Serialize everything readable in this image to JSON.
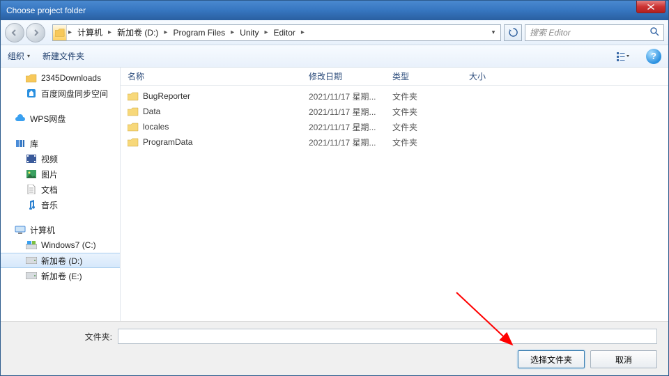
{
  "window": {
    "title": "Choose project folder"
  },
  "breadcrumb": {
    "segments": [
      "计算机",
      "新加卷 (D:)",
      "Program Files",
      "Unity",
      "Editor"
    ]
  },
  "search": {
    "placeholder": "搜索 Editor"
  },
  "toolbar": {
    "organize": "组织",
    "newfolder": "新建文件夹",
    "view_glyph": "☷",
    "help_glyph": "?"
  },
  "sidebar": {
    "top": [
      {
        "label": "2345Downloads",
        "icon": "folder"
      },
      {
        "label": "百度网盘同步空间",
        "icon": "baidu"
      }
    ],
    "wps": {
      "label": "WPS网盘"
    },
    "library": {
      "label": "库",
      "items": [
        {
          "label": "视频",
          "icon": "video"
        },
        {
          "label": "图片",
          "icon": "picture"
        },
        {
          "label": "文档",
          "icon": "doc"
        },
        {
          "label": "音乐",
          "icon": "music"
        }
      ]
    },
    "computer": {
      "label": "计算机",
      "items": [
        {
          "label": "Windows7 (C:)",
          "icon": "drive-win"
        },
        {
          "label": "新加卷 (D:)",
          "icon": "drive",
          "selected": true
        },
        {
          "label": "新加卷 (E:)",
          "icon": "drive"
        }
      ]
    }
  },
  "columns": {
    "name": "名称",
    "date": "修改日期",
    "type": "类型",
    "size": "大小"
  },
  "files": [
    {
      "name": "BugReporter",
      "date": "2021/11/17 星期...",
      "type": "文件夹"
    },
    {
      "name": "Data",
      "date": "2021/11/17 星期...",
      "type": "文件夹"
    },
    {
      "name": "locales",
      "date": "2021/11/17 星期...",
      "type": "文件夹"
    },
    {
      "name": "ProgramData",
      "date": "2021/11/17 星期...",
      "type": "文件夹"
    }
  ],
  "bottom": {
    "label": "文件夹:",
    "value": "",
    "select": "选择文件夹",
    "cancel": "取消"
  }
}
